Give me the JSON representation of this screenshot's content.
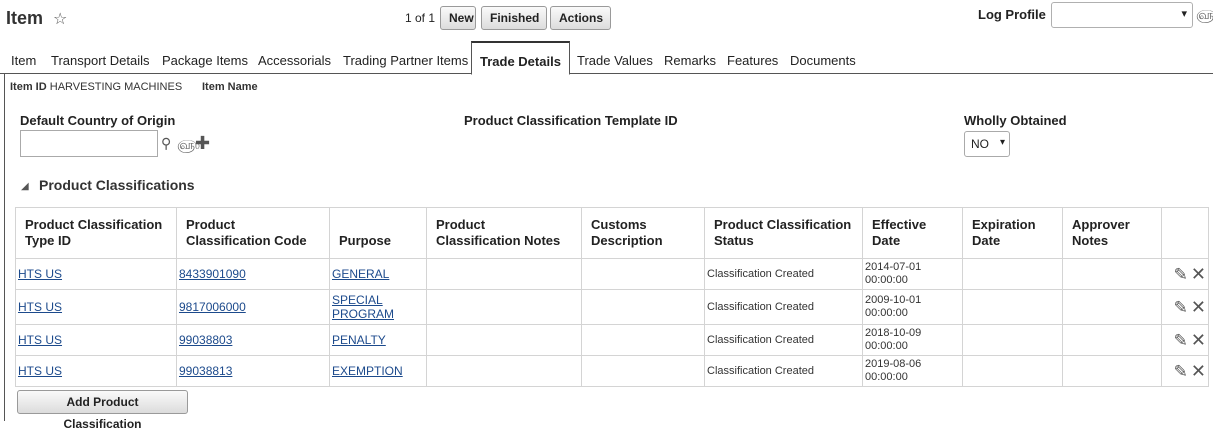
{
  "header": {
    "title": "Item",
    "pager": "1 of 1",
    "buttons": {
      "new": "New",
      "finished": "Finished",
      "actions": "Actions"
    },
    "log_profile_label": "Log Profile",
    "log_profile_value": ""
  },
  "tabs": [
    "Item",
    "Transport Details",
    "Package Items",
    "Accessorials",
    "Trading Partner Items",
    "Trade Details",
    "Trade Values",
    "Remarks",
    "Features",
    "Documents"
  ],
  "active_tab": "Trade Details",
  "info": {
    "item_id_label": "Item ID",
    "item_id_value": "HARVESTING MACHINES",
    "item_name_label": "Item Name",
    "item_name_value": ""
  },
  "form": {
    "default_country_label": "Default Country of Origin",
    "default_country_value": "",
    "template_id_label": "Product Classification Template ID",
    "wholly_obtained_label": "Wholly Obtained",
    "wholly_obtained_value": "NO"
  },
  "section": {
    "title": "Product Classifications",
    "expanded": true
  },
  "table": {
    "columns": [
      "Product Classification Type ID",
      "Product Classification Code",
      "Purpose",
      "Product Classification Notes",
      "Customs Description",
      "Product Classification Status",
      "Effective Date",
      "Expiration Date",
      "Approver Notes"
    ],
    "rows": [
      {
        "type_id": "HTS US",
        "code": "8433901090",
        "purpose": "GENERAL",
        "notes": "",
        "customs": "",
        "status": "Classification Created",
        "eff_date": "2014-07-01",
        "eff_time": "00:00:00",
        "exp_date": "",
        "approver": ""
      },
      {
        "type_id": "HTS US",
        "code": "9817006000",
        "purpose": "SPECIAL PROGRAM",
        "notes": "",
        "customs": "",
        "status": "Classification Created",
        "eff_date": "2009-10-01",
        "eff_time": "00:00:00",
        "exp_date": "",
        "approver": ""
      },
      {
        "type_id": "HTS US",
        "code": "99038803",
        "purpose": "PENALTY",
        "notes": "",
        "customs": "",
        "status": "Classification Created",
        "eff_date": "2018-10-09",
        "eff_time": "00:00:00",
        "exp_date": "",
        "approver": ""
      },
      {
        "type_id": "HTS US",
        "code": "99038813",
        "purpose": "EXEMPTION",
        "notes": "",
        "customs": "",
        "status": "Classification Created",
        "eff_date": "2019-08-06",
        "eff_time": "00:00:00",
        "exp_date": "",
        "approver": ""
      }
    ]
  },
  "add_button": "Add Product Classification",
  "icons": {
    "star": "star-icon",
    "glasses": "view-glasses-icon",
    "search": "search-icon",
    "plus": "add-icon",
    "edit": "pencil-icon",
    "delete": "close-x-icon"
  },
  "colors": {
    "link": "#1c4a8c",
    "border": "#d4d4d4",
    "text": "#222222"
  }
}
